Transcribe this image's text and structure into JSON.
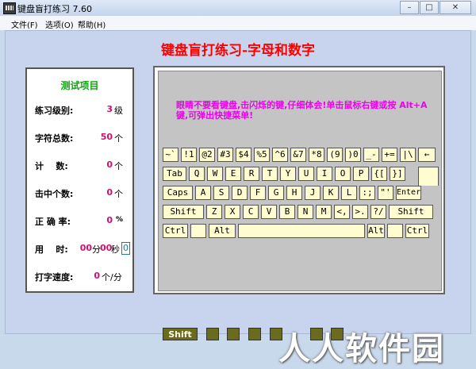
{
  "window": {
    "title": "键盘盲打练习 7.60",
    "minimize_glyph": "–",
    "maximize_glyph": "□",
    "close_glyph": "✕"
  },
  "menu": [
    "文件(F)",
    "选项(O)",
    "帮助(H)"
  ],
  "heading": "键盘盲打练习-字母和数字",
  "panel": {
    "title": "测试项目",
    "stats": [
      {
        "label": "练习级别:",
        "value": "3",
        "unit": "级"
      },
      {
        "label": "字符总数:",
        "value": "50",
        "unit": "个"
      },
      {
        "label": "计    数:",
        "value": "0",
        "unit": "个"
      },
      {
        "label": "击中个数:",
        "value": "0",
        "unit": "个"
      },
      {
        "label": "正 确 率:",
        "value": "0",
        "unit": "%"
      },
      {
        "label": "用    时:",
        "minutes": "00",
        "min_unit": "分",
        "seconds": "00",
        "sec_unit": "秒",
        "extra": "0"
      },
      {
        "label": "打字速度:",
        "value": "0",
        "unit": "个/分"
      }
    ]
  },
  "hint": "眼睛不要看键盘,击闪烁的键,仔细体会!单击鼠标右键或按 Alt+A 键,可弹出快捷菜单!",
  "keyboard": {
    "row1": [
      "~`",
      "!1",
      "@2",
      "#3",
      "$4",
      "%5",
      "^6",
      "&7",
      "*8",
      "(9",
      ")0",
      "_-",
      "+=",
      "|\\",
      "←"
    ],
    "row2": [
      "Tab",
      "Q",
      "W",
      "E",
      "R",
      "T",
      "Y",
      "U",
      "I",
      "O",
      "P",
      "{[",
      "}]"
    ],
    "row3": [
      "Caps",
      "A",
      "S",
      "D",
      "F",
      "G",
      "H",
      "J",
      "K",
      "L",
      ":;",
      "\"'",
      "Enter"
    ],
    "row4": [
      "Shift",
      "Z",
      "X",
      "C",
      "V",
      "B",
      "N",
      "M",
      "<,",
      ">.",
      "?/",
      "Shift"
    ],
    "row5": [
      "Ctrl",
      "",
      "Alt",
      "",
      "Alt",
      "",
      "Ctrl"
    ]
  },
  "indicator": {
    "shift_label": "Shift"
  },
  "watermark": "人人软件园"
}
